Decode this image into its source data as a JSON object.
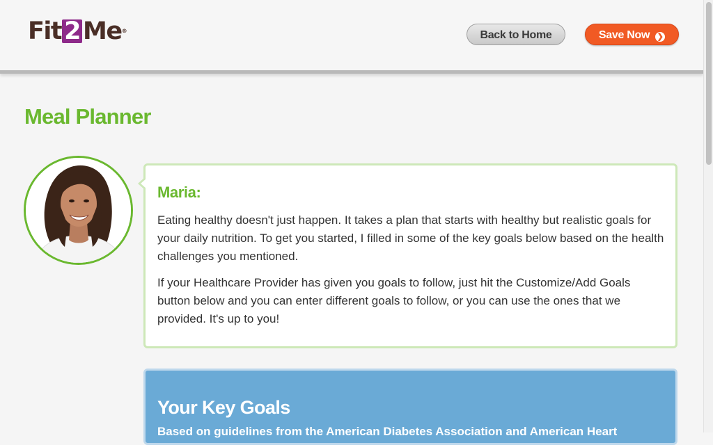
{
  "header": {
    "logo": {
      "prefix": "Fit",
      "number": "2",
      "suffix": "Me",
      "mark": "®"
    },
    "back_home_label": "Back to Home",
    "save_now_label": "Save Now",
    "save_icon": "chevron-right-circle-icon"
  },
  "page": {
    "title": "Meal Planner"
  },
  "coach": {
    "name": "Maria:",
    "paragraphs": [
      "Eating healthy doesn't just happen. It takes a plan that starts with healthy but realistic goals for your daily nutrition. To get you started, I filled in some of the key goals below based on the health challenges you mentioned.",
      "If your Healthcare Provider has given you goals to follow, just hit the Customize/Add Goals button below and you can enter different goals to follow, or you can use the ones that we provided. It's up to you!"
    ]
  },
  "goals": {
    "title": "Your Key Goals",
    "subtitle": "Based on guidelines from the American Diabetes Association and American Heart"
  },
  "colors": {
    "accent_green": "#6ab82f",
    "save_orange": "#f15a24",
    "goals_blue": "#6aaad6",
    "logo_brown": "#4a2e26",
    "logo_purple": "#8e2a8a"
  }
}
